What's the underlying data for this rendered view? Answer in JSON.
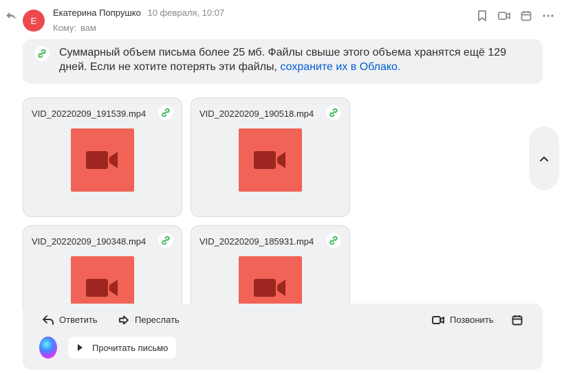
{
  "header": {
    "avatar_letter": "Е",
    "sender_name": "Екатерина Попрушко",
    "date": "10 февраля, 10:07",
    "to_label": "Кому:",
    "to_value": "вам"
  },
  "notice": {
    "text": "Суммарный объем письма более 25 мб. Файлы свыше этого объема хранятся ещё 129 дней. Если не хотите потерять эти файлы, ",
    "link": "сохраните их в Облако."
  },
  "attachments": [
    {
      "name": "VID_20220209_191539.mp4"
    },
    {
      "name": "VID_20220209_190518.mp4"
    },
    {
      "name": "VID_20220209_190348.mp4"
    },
    {
      "name": "VID_20220209_185931.mp4"
    }
  ],
  "actions": {
    "reply": "Ответить",
    "forward": "Переслать",
    "call": "Позвонить",
    "read_aloud": "Прочитать письмо"
  },
  "colors": {
    "accent_link": "#005bd1",
    "video_thumb": "#f06356",
    "link_icon": "#2fb54f",
    "avatar": "#ec4a4d"
  }
}
